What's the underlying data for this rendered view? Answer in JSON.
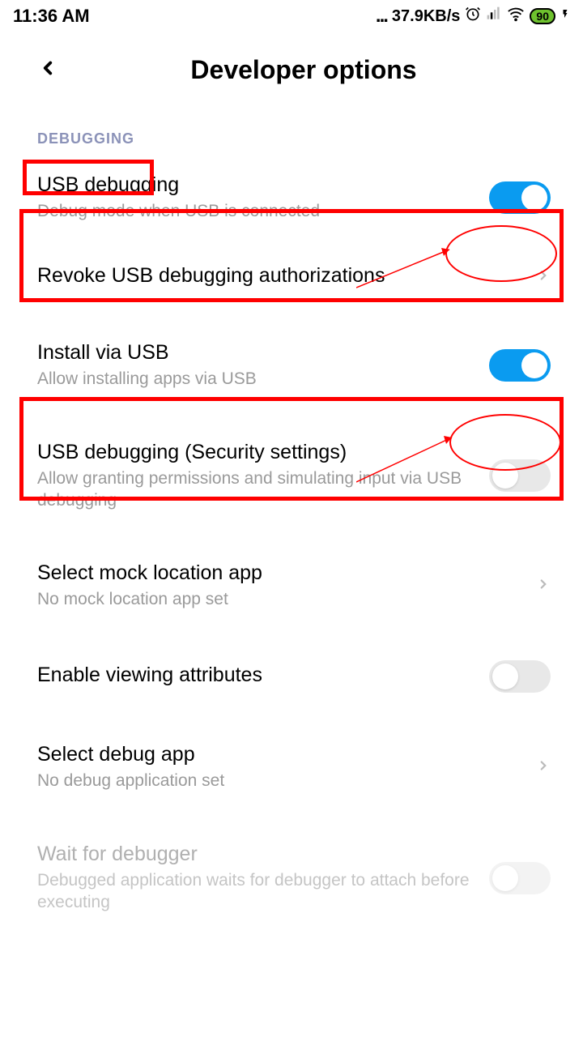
{
  "status": {
    "time": "11:36 AM",
    "speed": "37.9KB/s",
    "battery": "90"
  },
  "header": {
    "title": "Developer options"
  },
  "section": {
    "debugging": "DEBUGGING"
  },
  "items": {
    "usb_debugging": {
      "title": "USB debugging",
      "sub": "Debug mode when USB is connected"
    },
    "revoke": {
      "title": "Revoke USB debugging authorizations"
    },
    "install_usb": {
      "title": "Install via USB",
      "sub": "Allow installing apps via USB"
    },
    "security": {
      "title": "USB debugging (Security settings)",
      "sub": "Allow granting permissions and simulating input via USB debugging"
    },
    "mock_location": {
      "title": "Select mock location app",
      "sub": "No mock location app set"
    },
    "view_attrs": {
      "title": "Enable viewing attributes"
    },
    "debug_app": {
      "title": "Select debug app",
      "sub": "No debug application set"
    },
    "wait_debugger": {
      "title": "Wait for debugger",
      "sub": "Debugged application waits for debugger to attach before executing"
    }
  }
}
